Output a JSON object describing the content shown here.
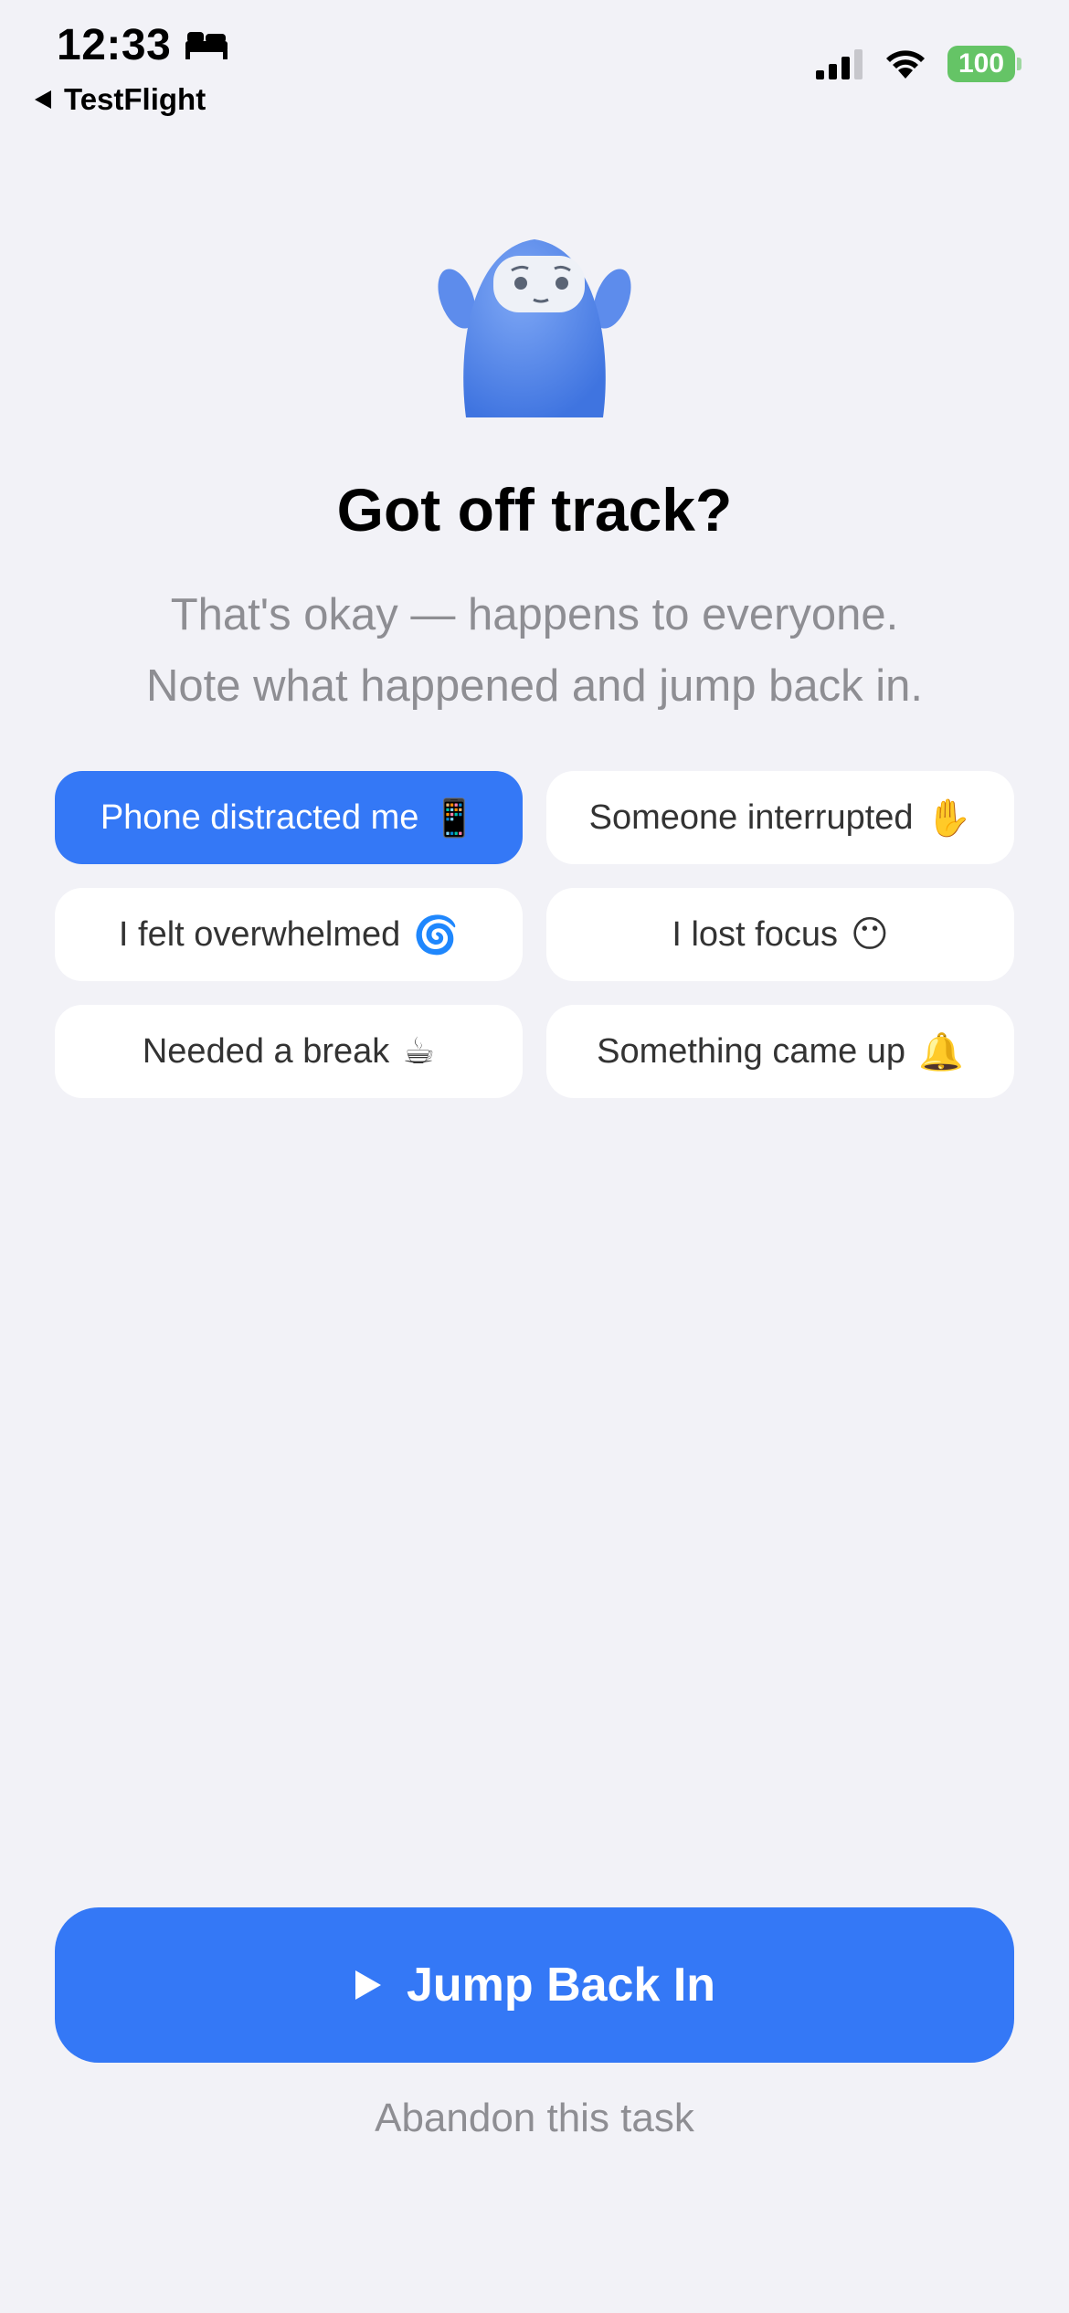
{
  "status_bar": {
    "time": "12:33",
    "back_app": "TestFlight",
    "battery": "100",
    "icons": [
      "bed-icon",
      "signal-icon",
      "wifi-icon",
      "battery-icon"
    ]
  },
  "header": {
    "title": "Got off track?",
    "subtitle_line1": "That's okay — happens to everyone.",
    "subtitle_line2": "Note what happened and jump back in."
  },
  "reasons": [
    {
      "label": "Phone distracted me",
      "emoji": "📱",
      "selected": true
    },
    {
      "label": "Someone interrupted",
      "emoji": "✋",
      "selected": false
    },
    {
      "label": "I felt overwhelmed",
      "emoji": "🌀",
      "selected": false
    },
    {
      "label": "I lost focus",
      "emoji": "😶",
      "selected": false
    },
    {
      "label": "Needed a break",
      "emoji": "☕",
      "selected": false
    },
    {
      "label": "Something came up",
      "emoji": "🔔",
      "selected": false
    }
  ],
  "actions": {
    "primary_label": "Jump Back In",
    "secondary_label": "Abandon this task"
  },
  "colors": {
    "accent": "#3478f6",
    "background": "#f2f2f7",
    "muted_text": "#8e8e93",
    "battery_green": "#65c466"
  }
}
